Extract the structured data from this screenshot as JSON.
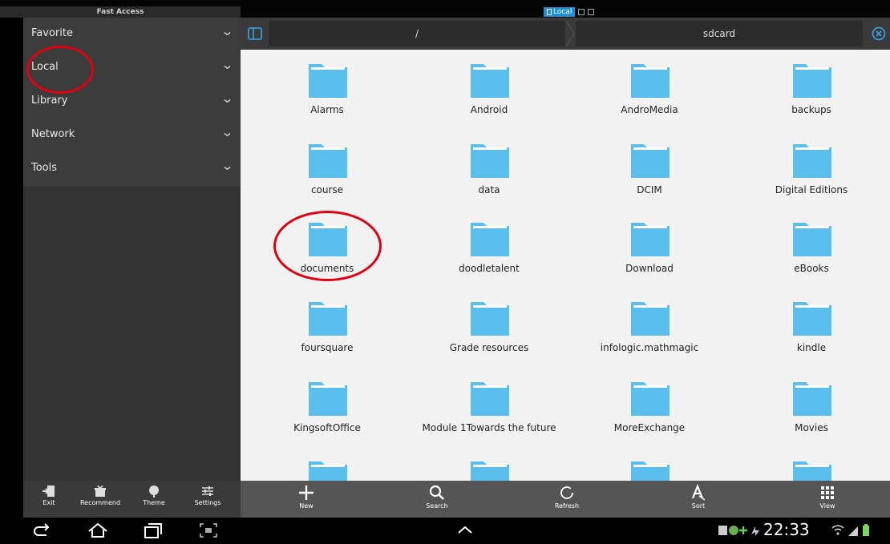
{
  "status_bar": {
    "title": "Fast Access",
    "active_tab": "Local"
  },
  "sidebar": {
    "items": [
      {
        "label": "Favorite"
      },
      {
        "label": "Local"
      },
      {
        "label": "Library"
      },
      {
        "label": "Network"
      },
      {
        "label": "Tools"
      }
    ],
    "toolbar": [
      {
        "label": "Exit",
        "icon": "exit-icon"
      },
      {
        "label": "Recommend",
        "icon": "gift-icon"
      },
      {
        "label": "Theme",
        "icon": "theme-icon"
      },
      {
        "label": "Settings",
        "icon": "settings-icon"
      }
    ]
  },
  "path_bar": {
    "root": "/",
    "current": "sdcard"
  },
  "folders": [
    "Alarms",
    "Android",
    "AndroMedia",
    "backups",
    "course",
    "data",
    "DCIM",
    "Digital Editions",
    "documents",
    "doodletalent",
    "Download",
    "eBooks",
    "foursquare",
    "Grade resources",
    "infologic.mathmagic",
    "kindle",
    "KingsoftOffice",
    "Module 1Towards the future",
    "MoreExchange",
    "Movies",
    "",
    "",
    "",
    ""
  ],
  "main_toolbar": [
    {
      "label": "New",
      "icon": "plus-icon"
    },
    {
      "label": "Search",
      "icon": "search-icon"
    },
    {
      "label": "Refresh",
      "icon": "refresh-icon"
    },
    {
      "label": "Sort",
      "icon": "sort-icon"
    },
    {
      "label": "View",
      "icon": "grid-view-icon"
    }
  ],
  "system_bar": {
    "time": "22:33"
  },
  "colors": {
    "folder": "#5bbfee",
    "accent": "#1f8ed6",
    "annotation": "#e3000f"
  }
}
